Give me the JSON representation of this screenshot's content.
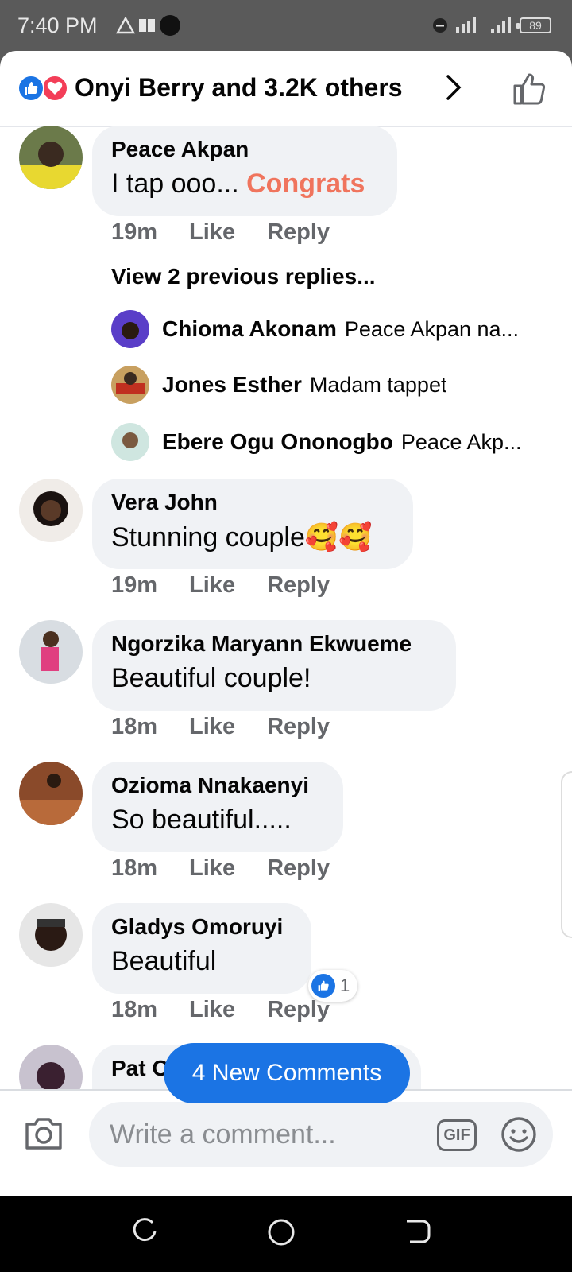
{
  "status_bar": {
    "time": "7:40 PM",
    "battery": "89"
  },
  "header": {
    "title": "Onyi Berry and 3.2K others"
  },
  "comments": [
    {
      "name": "Peace Akpan",
      "text": "I tap ooo...",
      "highlight": "Congrats",
      "time": "19m",
      "like": "Like",
      "reply": "Reply"
    },
    {
      "name": "Vera John",
      "text": "Stunning couple🥰🥰",
      "time": "19m",
      "like": "Like",
      "reply": "Reply"
    },
    {
      "name": "Ngorzika Maryann Ekwueme",
      "text": "Beautiful couple!",
      "time": "18m",
      "like": "Like",
      "reply": "Reply"
    },
    {
      "name": "Ozioma Nnakaenyi",
      "text": "So beautiful.....",
      "time": "18m",
      "like": "Like",
      "reply": "Reply"
    },
    {
      "name": "Gladys Omoruyi",
      "text": "Beautiful",
      "time": "18m",
      "like": "Like",
      "reply": "Reply",
      "reaction_count": "1"
    },
    {
      "name": "Pat Oj"
    }
  ],
  "replies": {
    "view_previous": "View 2 previous replies...",
    "items": [
      {
        "name": "Chioma Akonam",
        "text": "Peace Akpan na..."
      },
      {
        "name": "Jones Esther",
        "text": "Madam tappet"
      },
      {
        "name": "Ebere Ogu Ononogbo",
        "text": "Peace Akp..."
      }
    ]
  },
  "new_comments_button": "4 New Comments",
  "composer": {
    "placeholder": "Write a comment...",
    "gif": "GIF"
  },
  "colors": {
    "accent": "#1b74e4",
    "love": "#f33e58",
    "highlight": "#f0745d",
    "bubble": "#f0f2f5"
  }
}
